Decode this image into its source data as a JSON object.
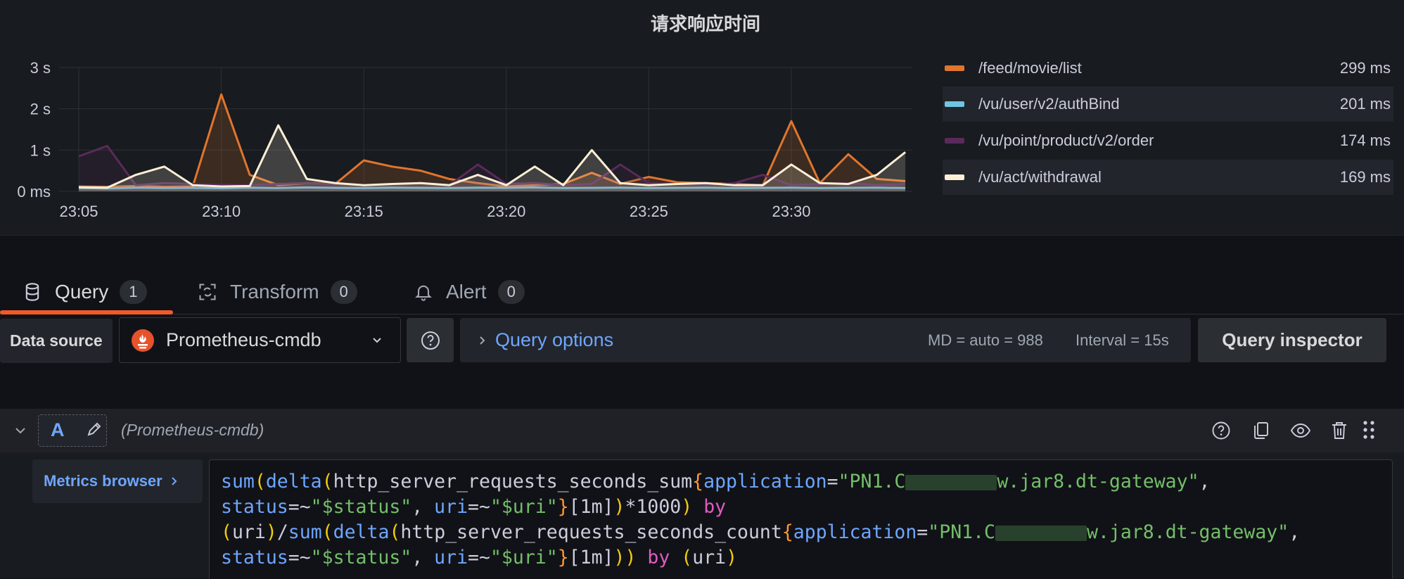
{
  "panel": {
    "title": "请求响应时间",
    "legend": [
      {
        "label": "/feed/movie/list",
        "value": "299 ms",
        "color": "#e0752d"
      },
      {
        "label": "/vu/user/v2/authBind",
        "value": "201 ms",
        "color": "#6ec6e2"
      },
      {
        "label": "/vu/point/product/v2/order",
        "value": "174 ms",
        "color": "#5a2a5a"
      },
      {
        "label": "/vu/act/withdrawal",
        "value": "169 ms",
        "color": "#fcefd6"
      }
    ]
  },
  "chart_data": {
    "type": "line",
    "title": "请求响应时间",
    "x_ticks": [
      "23:05",
      "23:10",
      "23:15",
      "23:20",
      "23:25",
      "23:30"
    ],
    "y_ticks": [
      "3 s",
      "2 s",
      "1 s",
      "0 ms"
    ],
    "ylim_ms": [
      0,
      3000
    ],
    "x_minutes": [
      23.05,
      23.06,
      23.07,
      23.08,
      23.09,
      23.1,
      23.11,
      23.12,
      23.13,
      23.14,
      23.15,
      23.16,
      23.17,
      23.18,
      23.19,
      23.2,
      23.21,
      23.22,
      23.23,
      23.24,
      23.25,
      23.26,
      23.27,
      23.28,
      23.29,
      23.3,
      23.31,
      23.32,
      23.33,
      23.34
    ],
    "series": [
      {
        "name": "/feed/movie/list",
        "color": "#e0752d",
        "values_ms": [
          120,
          110,
          130,
          110,
          120,
          2350,
          400,
          150,
          200,
          180,
          750,
          600,
          500,
          300,
          200,
          120,
          150,
          180,
          450,
          180,
          350,
          220,
          200,
          180,
          150,
          1700,
          200,
          900,
          300,
          250
        ]
      },
      {
        "name": "/vu/user/v2/authBind",
        "color": "#6ec6e2",
        "values_ms": [
          80,
          70,
          90,
          80,
          85,
          75,
          90,
          80,
          95,
          85,
          80,
          90,
          85,
          80,
          90,
          85,
          95,
          80,
          85,
          90,
          80,
          85,
          90,
          80,
          85,
          90,
          80,
          85,
          90,
          80
        ]
      },
      {
        "name": "/vu/point/product/v2/order",
        "color": "#5a2a5a",
        "values_ms": [
          850,
          1100,
          150,
          200,
          180,
          160,
          150,
          180,
          200,
          170,
          150,
          180,
          200,
          150,
          650,
          180,
          200,
          150,
          180,
          650,
          200,
          180,
          150,
          200,
          400,
          150,
          180,
          200,
          150,
          180
        ]
      },
      {
        "name": "/vu/act/withdrawal",
        "color": "#fcefd6",
        "values_ms": [
          100,
          90,
          400,
          600,
          150,
          120,
          130,
          1600,
          300,
          200,
          150,
          180,
          200,
          150,
          400,
          150,
          600,
          150,
          1000,
          200,
          150,
          180,
          200,
          150,
          150,
          650,
          200,
          180,
          400,
          950
        ]
      }
    ]
  },
  "tabs": [
    {
      "label": "Query",
      "count": "1",
      "icon": "database-icon"
    },
    {
      "label": "Transform",
      "count": "0",
      "icon": "transform-icon"
    },
    {
      "label": "Alert",
      "count": "0",
      "icon": "bell-icon"
    }
  ],
  "datasource": {
    "label": "Data source",
    "name": "Prometheus-cmdb",
    "query_options_label": "Query options",
    "md_text": "MD = auto = 988",
    "interval_text": "Interval = 15s",
    "inspector_label": "Query inspector"
  },
  "query": {
    "ref_id": "A",
    "datasource_hint": "(Prometheus-cmdb)",
    "metrics_browser_label": "Metrics browser",
    "expr_app_prefix": "PN1.C",
    "expr_app_suffix": "w.jar8.dt-gateway",
    "expr_metric_sum": "http_server_requests_seconds_sum",
    "expr_metric_count": "http_server_requests_seconds_count"
  },
  "colors": {
    "accent": "#f05a28",
    "link": "#6ea6ff",
    "background": "#111217",
    "panel": "#181b1f"
  }
}
